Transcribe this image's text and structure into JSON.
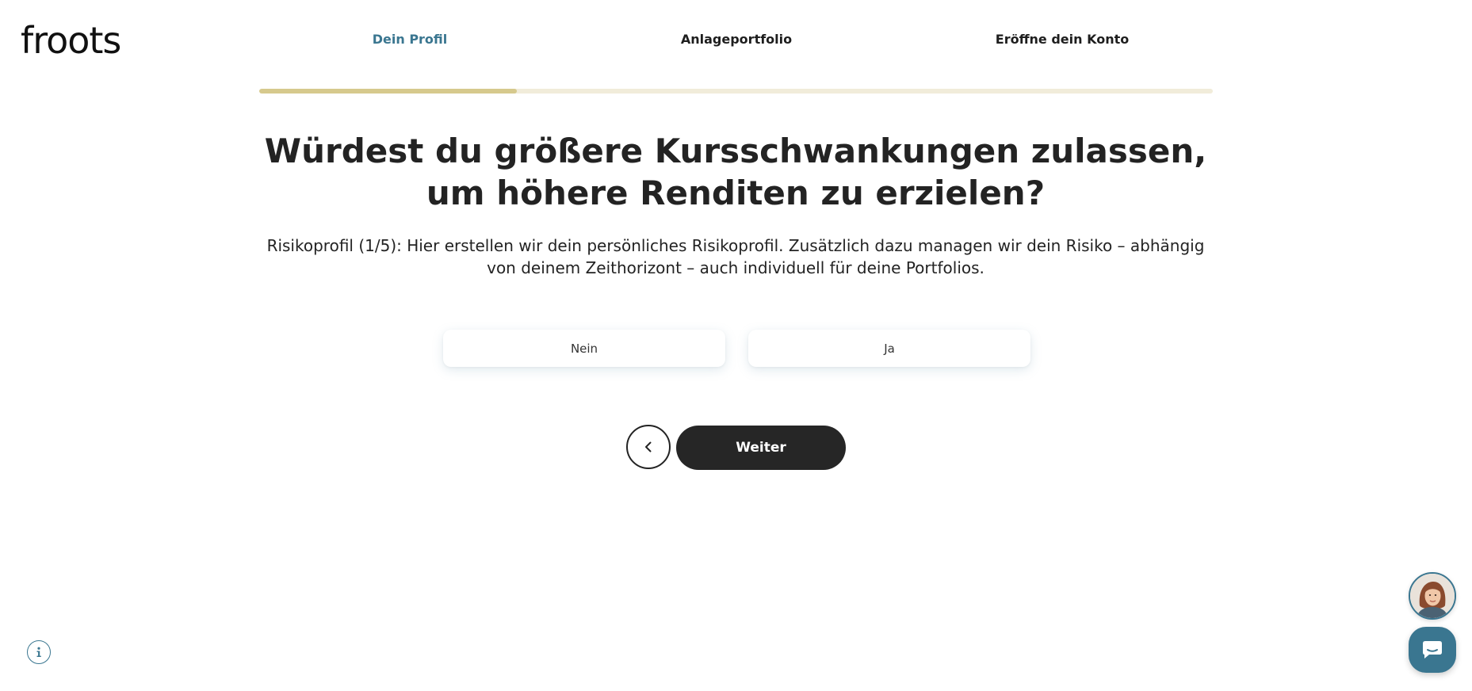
{
  "brand": {
    "logo_text": "froots"
  },
  "steps": [
    {
      "label": "Dein Profil",
      "active": true
    },
    {
      "label": "Anlageportfolio",
      "active": false
    },
    {
      "label": "Eröffne dein Konto",
      "active": false
    }
  ],
  "progress": {
    "fraction": 0.27
  },
  "question": {
    "title": "Würdest du größere Kursschwankungen zulassen, um höhere Renditen zu erzielen?",
    "description": "Risikoprofil (1/5): Hier erstellen wir dein persönliches Risikoprofil. Zusätzlich dazu managen wir dein Risiko – abhängig von deinem Zeithorizont – auch individuell für deine Portfolios."
  },
  "options": [
    {
      "label": "Nein"
    },
    {
      "label": "Ja"
    }
  ],
  "navigation": {
    "next_label": "Weiter"
  },
  "icons": {
    "back": "chevron-left-icon",
    "info": "info-icon",
    "chat": "chat-bubble-icon",
    "avatar": "support-agent-avatar"
  },
  "colors": {
    "accent": "#3a7690",
    "progress_fill": "#d6c98d",
    "progress_track": "#f1ecda",
    "button_dark": "#262626",
    "text": "#232323"
  }
}
